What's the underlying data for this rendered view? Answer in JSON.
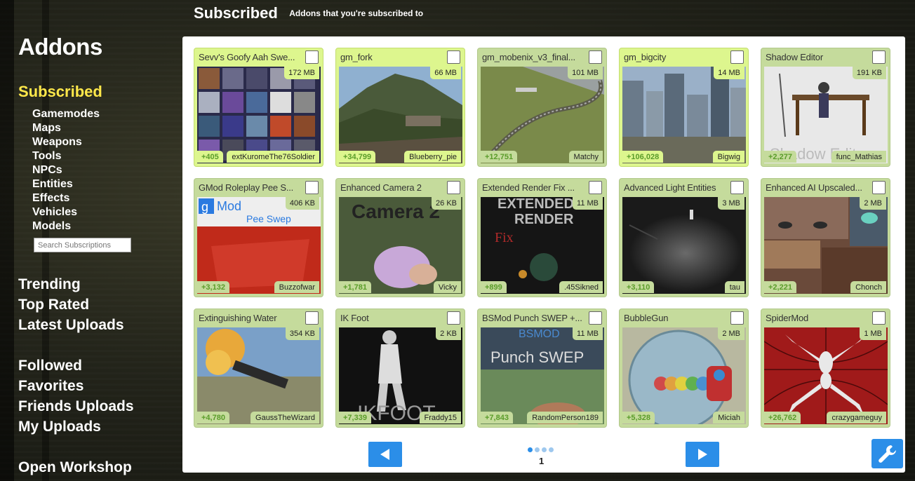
{
  "sidebar": {
    "title": "Addons",
    "subscribed_label": "Subscribed",
    "categories": [
      "Gamemodes",
      "Maps",
      "Weapons",
      "Tools",
      "NPCs",
      "Entities",
      "Effects",
      "Vehicles",
      "Models"
    ],
    "search_placeholder": "Search Subscriptions",
    "group1": [
      "Trending",
      "Top Rated",
      "Latest Uploads"
    ],
    "group2": [
      "Followed",
      "Favorites",
      "Friends Uploads",
      "My Uploads"
    ],
    "open_workshop": "Open Workshop"
  },
  "header": {
    "title": "Subscribed",
    "subtitle": "Addons that you're subscribed to"
  },
  "addons": [
    {
      "title": "Sevv's Goofy Aah Swe...",
      "size": "172 MB",
      "score": "+405",
      "author": "extKuromeThe76Soldier",
      "highlighted": true
    },
    {
      "title": "gm_fork",
      "size": "66 MB",
      "score": "+34,799",
      "author": "Blueberry_pie",
      "highlighted": true
    },
    {
      "title": "gm_mobenix_v3_final...",
      "size": "101 MB",
      "score": "+12,751",
      "author": "Matchy",
      "highlighted": false
    },
    {
      "title": "gm_bigcity",
      "size": "14 MB",
      "score": "+106,028",
      "author": "Bigwig",
      "highlighted": true
    },
    {
      "title": "Shadow Editor",
      "size": "191 KB",
      "score": "+2,277",
      "author": "func_Mathias",
      "highlighted": false
    },
    {
      "title": "GMod Roleplay Pee S...",
      "size": "406 KB",
      "score": "+3,132",
      "author": "Buzzofwar",
      "highlighted": false
    },
    {
      "title": "Enhanced Camera 2",
      "size": "26 KB",
      "score": "+1,781",
      "author": "Vicky",
      "highlighted": false
    },
    {
      "title": "Extended Render Fix ...",
      "size": "11 MB",
      "score": "+899",
      "author": ".45Sikned",
      "highlighted": false
    },
    {
      "title": "Advanced Light Entities",
      "size": "3 MB",
      "score": "+3,110",
      "author": "tau",
      "highlighted": false
    },
    {
      "title": "Enhanced AI Upscaled...",
      "size": "2 MB",
      "score": "+2,221",
      "author": "Chonch",
      "highlighted": false
    },
    {
      "title": "Extinguishing Water",
      "size": "354 KB",
      "score": "+4,780",
      "author": "GaussTheWizard",
      "highlighted": false
    },
    {
      "title": "IK Foot",
      "size": "2 KB",
      "score": "+7,339",
      "author": "Fraddy15",
      "highlighted": false
    },
    {
      "title": "BSMod Punch SWEP +...",
      "size": "11 MB",
      "score": "+7,843",
      "author": "RandomPerson189",
      "highlighted": false
    },
    {
      "title": "BubbleGun",
      "size": "2 MB",
      "score": "+5,328",
      "author": "Miciah",
      "highlighted": false
    },
    {
      "title": "SpiderMod",
      "size": "1 MB",
      "score": "+26,762",
      "author": "crazygameguy",
      "highlighted": false
    }
  ],
  "thumb_text": {
    "pee_swep": [
      "Mod",
      "Pee  Swep"
    ],
    "camera": "Camera 2",
    "render": [
      "EXTENDED",
      "RENDER",
      "Fix"
    ],
    "punch": [
      "BSMOD",
      "Punch SWEP"
    ],
    "ikfoot": "IKFOOT",
    "shadow": "Shadow Edit"
  },
  "pagination": {
    "page": "1",
    "dots": 4,
    "active_dot": 0
  },
  "colors": {
    "accent": "#2b8ee8",
    "card": "#c5db9c",
    "card_highlight": "#ddf68e",
    "subscribed": "#ffe84a",
    "score": "#5a9c2a"
  }
}
